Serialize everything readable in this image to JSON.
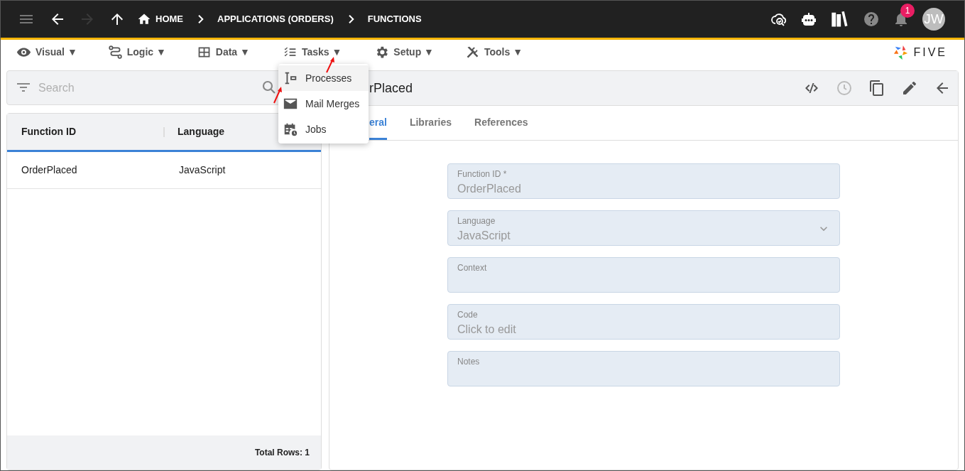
{
  "topbar": {
    "breadcrumbs": [
      "HOME",
      "APPLICATIONS (ORDERS)",
      "FUNCTIONS"
    ],
    "notification_count": "1",
    "avatar": "JW"
  },
  "menu": [
    {
      "label": "Visual ▼"
    },
    {
      "label": "Logic ▼"
    },
    {
      "label": "Data ▼"
    },
    {
      "label": "Tasks ▼"
    },
    {
      "label": "Setup ▼"
    },
    {
      "label": "Tools ▼"
    }
  ],
  "logo": "FIVE",
  "dropdown": [
    {
      "label": "Processes",
      "selected": true
    },
    {
      "label": "Mail Merges",
      "selected": false
    },
    {
      "label": "Jobs",
      "selected": false
    }
  ],
  "search": {
    "placeholder": "Search"
  },
  "table": {
    "columns": [
      "Function ID",
      "Language"
    ],
    "rows": [
      [
        "OrderPlaced",
        "JavaScript"
      ]
    ],
    "footer": "Total Rows: 1"
  },
  "detail": {
    "title": "rPlaced",
    "tabs": [
      {
        "label": "eral",
        "selected": true
      },
      {
        "label": "Libraries",
        "selected": false
      },
      {
        "label": "References",
        "selected": false
      }
    ],
    "fields": [
      {
        "label": "Function ID *",
        "value": "OrderPlaced",
        "kind": "text"
      },
      {
        "label": "Language",
        "value": "JavaScript",
        "kind": "select"
      },
      {
        "label": "Context",
        "kind": "text"
      },
      {
        "label": "Code",
        "value": "Click to edit",
        "kind": "text"
      },
      {
        "label": "Notes",
        "kind": "text"
      }
    ]
  }
}
